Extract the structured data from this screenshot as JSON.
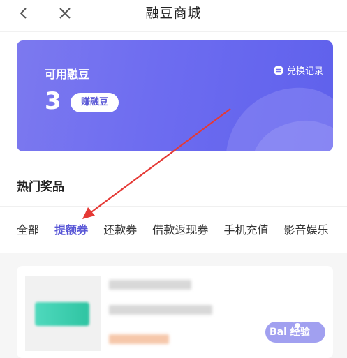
{
  "nav": {
    "title": "融豆商城"
  },
  "banner": {
    "label": "可用融豆",
    "count": "3",
    "earn_button": "赚融豆",
    "record_link": "兑换记录"
  },
  "section": {
    "title": "热门奖品"
  },
  "tabs": [
    {
      "label": "全部",
      "active": false
    },
    {
      "label": "提额券",
      "active": true
    },
    {
      "label": "还款券",
      "active": false
    },
    {
      "label": "借款返现券",
      "active": false
    },
    {
      "label": "手机充值",
      "active": false
    },
    {
      "label": "影音娱乐",
      "active": false
    }
  ],
  "watermark": {
    "text": "Bai 经验"
  },
  "colors": {
    "accent": "#5856d6",
    "banner": "#6d6cf0",
    "annotation_arrow": "#e53935"
  },
  "icons": [
    "back-arrow-icon",
    "close-icon",
    "exchange-record-icon"
  ]
}
